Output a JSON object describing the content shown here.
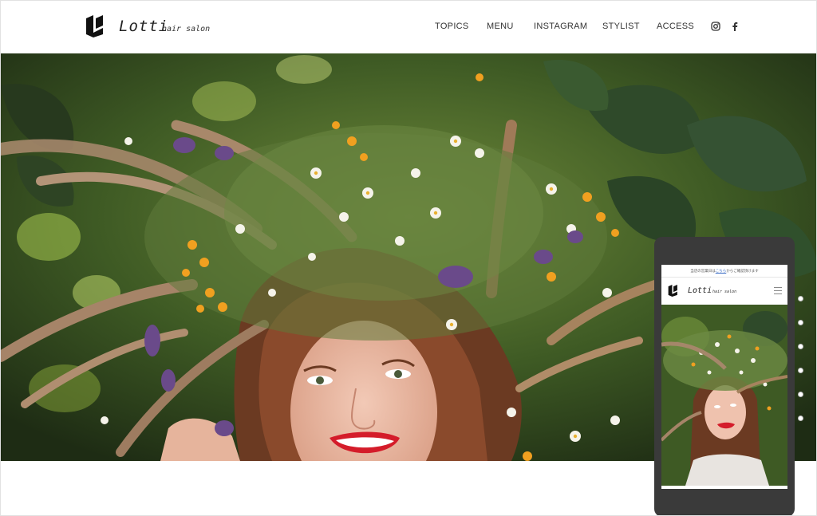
{
  "brand": {
    "name": "Lotti",
    "subtitle": "hair salon",
    "logo": "lotti-logo-mark"
  },
  "nav": [
    {
      "label": "TOPICS"
    },
    {
      "label": "MENU"
    },
    {
      "label": "INSTAGRAM"
    },
    {
      "label": "STYLIST"
    },
    {
      "label": "ACCESS"
    }
  ],
  "social": [
    {
      "icon": "instagram-icon"
    },
    {
      "icon": "facebook-icon"
    }
  ],
  "hero": {
    "image": "woman-with-flower-wreath",
    "slide_count": 6
  },
  "mobile": {
    "notice_prefix": "当店の営業日は",
    "notice_link": "こちら",
    "notice_suffix": "からご確認頂けます",
    "brand_name": "Lotti",
    "brand_subtitle": "hair salon",
    "menu_icon": "hamburger-icon"
  },
  "colors": {
    "phone_body": "#3a3a3a",
    "lips": "#d41c2a",
    "text": "#333333"
  }
}
